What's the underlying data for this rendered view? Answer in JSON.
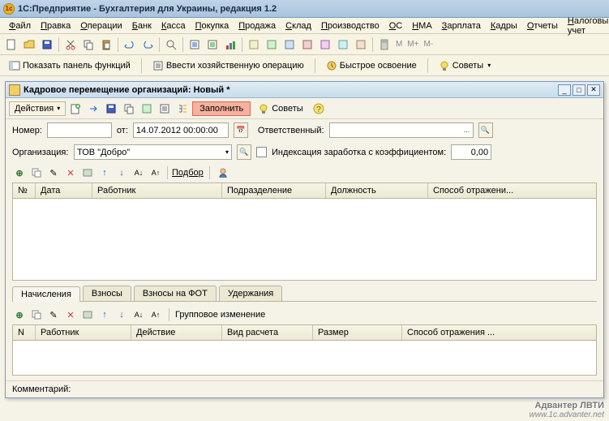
{
  "app": {
    "logo_char": "1c",
    "title": "1С:Предприятие - Бухгалтерия для Украины, редакция 1.2"
  },
  "menu": {
    "file": "Файл",
    "edit": "Правка",
    "ops": "Операции",
    "bank": "Банк",
    "kassa": "Касса",
    "buy": "Покупка",
    "sell": "Продажа",
    "sklad": "Склад",
    "proizv": "Производство",
    "os": "ОС",
    "nma": "НМА",
    "zp": "Зарплата",
    "kadry": "Кадры",
    "reports": "Отчеты",
    "tax": "Налоговый учет"
  },
  "toolbar1": {
    "calc_tip": "M",
    "calc_tip2": "M+",
    "calc_tip3": "M-"
  },
  "toolbar2": {
    "show_panel": "Показать панель функций",
    "enter_op": "Ввести хозяйственную операцию",
    "fast": "Быстрое освоение",
    "advice": "Советы"
  },
  "doc": {
    "title": "Кадровое перемещение организаций: Новый *",
    "actions": "Действия",
    "fill": "Заполнить",
    "advice": "Советы",
    "nomer": "Номер:",
    "ot": "от:",
    "date": "14.07.2012 00:00:00",
    "resp": "Ответственный:",
    "org": "Организация:",
    "org_val": "ТОВ \"Добро\"",
    "index": "Индексация заработка с коэффициентом:",
    "coef": "0,00",
    "podbor": "Подбор",
    "grid1": {
      "n": "№",
      "date": "Дата",
      "worker": "Работник",
      "podr": "Подразделение",
      "dolzh": "Должность",
      "sposob": "Способ отражени..."
    },
    "tabs": {
      "nach": "Начисления",
      "vzn": "Взносы",
      "vznfot": "Взносы на ФОТ",
      "uderzh": "Удержания"
    },
    "group_change": "Групповое изменение",
    "grid2": {
      "n": "N",
      "worker": "Работник",
      "action": "Действие",
      "vid": "Вид расчета",
      "size": "Размер",
      "sposob": "Способ отражения ..."
    },
    "comment": "Комментарий:"
  },
  "watermark": {
    "brand": "Адвантер ЛВТИ",
    "url": "www.1c.advanter.net"
  }
}
